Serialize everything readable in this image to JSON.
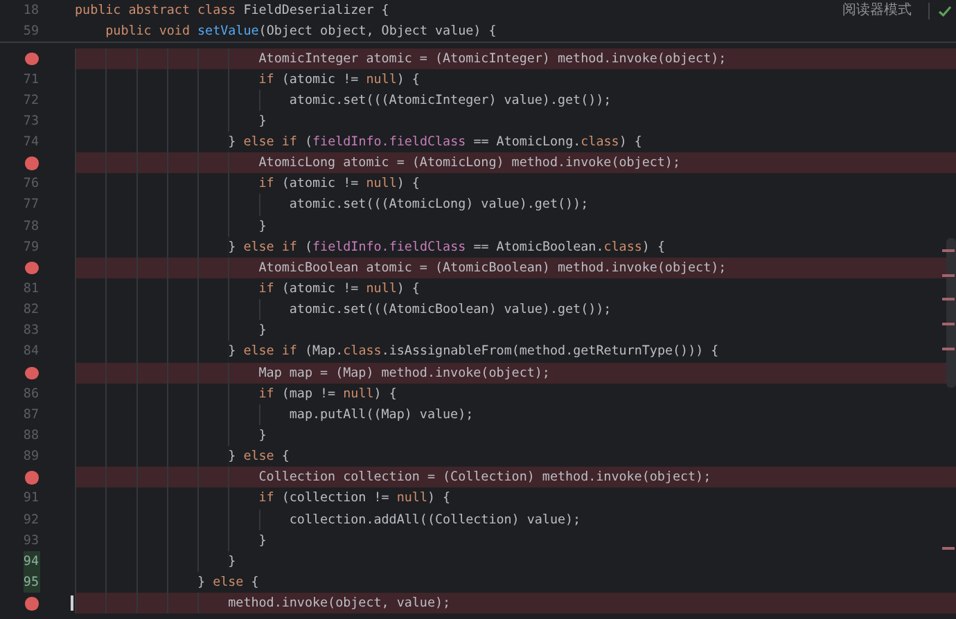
{
  "reader_mode": {
    "label": "阅读器模式"
  },
  "sticky_lines": [
    {
      "number": "18",
      "tokens": [
        {
          "text": "public abstract class",
          "kind": "keyword"
        },
        {
          "text": " FieldDeserializer {",
          "kind": "plain"
        }
      ]
    },
    {
      "number": "59",
      "tokens": [
        {
          "text": "    public void ",
          "kind": "keyword"
        },
        {
          "text": "setValue",
          "kind": "method"
        },
        {
          "text": "(Object object, Object value) {",
          "kind": "plain"
        }
      ]
    }
  ],
  "lines": [
    {
      "breakpoint": true,
      "changed": false,
      "tokens": [
        {
          "text": "                        AtomicInteger atomic = (AtomicInteger) method.invoke(object);",
          "kind": "plain"
        }
      ]
    },
    {
      "number": "71",
      "breakpoint": false,
      "changed": false,
      "tokens": [
        {
          "text": "                        if",
          "kind": "keyword"
        },
        {
          "text": " (atomic != ",
          "kind": "plain"
        },
        {
          "text": "null",
          "kind": "keyword"
        },
        {
          "text": ") {",
          "kind": "plain"
        }
      ]
    },
    {
      "number": "72",
      "breakpoint": false,
      "changed": false,
      "tokens": [
        {
          "text": "                            atomic.set(((AtomicInteger) value).get());",
          "kind": "plain"
        }
      ]
    },
    {
      "number": "73",
      "breakpoint": false,
      "changed": false,
      "tokens": [
        {
          "text": "                        }",
          "kind": "plain"
        }
      ]
    },
    {
      "number": "74",
      "breakpoint": false,
      "changed": false,
      "tokens": [
        {
          "text": "                    } ",
          "kind": "plain"
        },
        {
          "text": "else if",
          "kind": "keyword"
        },
        {
          "text": " (",
          "kind": "plain"
        },
        {
          "text": "fieldInfo.fieldClass",
          "kind": "field"
        },
        {
          "text": " == AtomicLong.",
          "kind": "plain"
        },
        {
          "text": "class",
          "kind": "keyword"
        },
        {
          "text": ") {",
          "kind": "plain"
        }
      ]
    },
    {
      "breakpoint": true,
      "changed": false,
      "tokens": [
        {
          "text": "                        AtomicLong atomic = (AtomicLong) method.invoke(object);",
          "kind": "plain"
        }
      ]
    },
    {
      "number": "76",
      "breakpoint": false,
      "changed": false,
      "tokens": [
        {
          "text": "                        if",
          "kind": "keyword"
        },
        {
          "text": " (atomic != ",
          "kind": "plain"
        },
        {
          "text": "null",
          "kind": "keyword"
        },
        {
          "text": ") {",
          "kind": "plain"
        }
      ]
    },
    {
      "number": "77",
      "breakpoint": false,
      "changed": false,
      "tokens": [
        {
          "text": "                            atomic.set(((AtomicLong) value).get());",
          "kind": "plain"
        }
      ]
    },
    {
      "number": "78",
      "breakpoint": false,
      "changed": false,
      "tokens": [
        {
          "text": "                        }",
          "kind": "plain"
        }
      ]
    },
    {
      "number": "79",
      "breakpoint": false,
      "changed": false,
      "tokens": [
        {
          "text": "                    } ",
          "kind": "plain"
        },
        {
          "text": "else if",
          "kind": "keyword"
        },
        {
          "text": " (",
          "kind": "plain"
        },
        {
          "text": "fieldInfo.fieldClass",
          "kind": "field"
        },
        {
          "text": " == AtomicBoolean.",
          "kind": "plain"
        },
        {
          "text": "class",
          "kind": "keyword"
        },
        {
          "text": ") {",
          "kind": "plain"
        }
      ]
    },
    {
      "breakpoint": true,
      "changed": false,
      "tokens": [
        {
          "text": "                        AtomicBoolean atomic = (AtomicBoolean) method.invoke(object);",
          "kind": "plain"
        }
      ]
    },
    {
      "number": "81",
      "breakpoint": false,
      "changed": false,
      "tokens": [
        {
          "text": "                        if",
          "kind": "keyword"
        },
        {
          "text": " (atomic != ",
          "kind": "plain"
        },
        {
          "text": "null",
          "kind": "keyword"
        },
        {
          "text": ") {",
          "kind": "plain"
        }
      ]
    },
    {
      "number": "82",
      "breakpoint": false,
      "changed": false,
      "tokens": [
        {
          "text": "                            atomic.set(((AtomicBoolean) value).get());",
          "kind": "plain"
        }
      ]
    },
    {
      "number": "83",
      "breakpoint": false,
      "changed": false,
      "tokens": [
        {
          "text": "                        }",
          "kind": "plain"
        }
      ]
    },
    {
      "number": "84",
      "breakpoint": false,
      "changed": false,
      "tokens": [
        {
          "text": "                    } ",
          "kind": "plain"
        },
        {
          "text": "else if",
          "kind": "keyword"
        },
        {
          "text": " (Map.",
          "kind": "plain"
        },
        {
          "text": "class",
          "kind": "keyword"
        },
        {
          "text": ".isAssignableFrom(method.getReturnType())) {",
          "kind": "plain"
        }
      ]
    },
    {
      "breakpoint": true,
      "changed": false,
      "tokens": [
        {
          "text": "                        Map map = (Map) method.invoke(object);",
          "kind": "plain"
        }
      ]
    },
    {
      "number": "86",
      "breakpoint": false,
      "changed": false,
      "tokens": [
        {
          "text": "                        if",
          "kind": "keyword"
        },
        {
          "text": " (map != ",
          "kind": "plain"
        },
        {
          "text": "null",
          "kind": "keyword"
        },
        {
          "text": ") {",
          "kind": "plain"
        }
      ]
    },
    {
      "number": "87",
      "breakpoint": false,
      "changed": false,
      "tokens": [
        {
          "text": "                            map.putAll((Map) value);",
          "kind": "plain"
        }
      ]
    },
    {
      "number": "88",
      "breakpoint": false,
      "changed": false,
      "tokens": [
        {
          "text": "                        }",
          "kind": "plain"
        }
      ]
    },
    {
      "number": "89",
      "breakpoint": false,
      "changed": false,
      "tokens": [
        {
          "text": "                    } ",
          "kind": "plain"
        },
        {
          "text": "else",
          "kind": "keyword"
        },
        {
          "text": " {",
          "kind": "plain"
        }
      ]
    },
    {
      "breakpoint": true,
      "changed": false,
      "tokens": [
        {
          "text": "                        Collection collection = (Collection) method.invoke(object);",
          "kind": "plain"
        }
      ]
    },
    {
      "number": "91",
      "breakpoint": false,
      "changed": false,
      "tokens": [
        {
          "text": "                        if",
          "kind": "keyword"
        },
        {
          "text": " (collection != ",
          "kind": "plain"
        },
        {
          "text": "null",
          "kind": "keyword"
        },
        {
          "text": ") {",
          "kind": "plain"
        }
      ]
    },
    {
      "number": "92",
      "breakpoint": false,
      "changed": false,
      "tokens": [
        {
          "text": "                            collection.addAll((Collection) value);",
          "kind": "plain"
        }
      ]
    },
    {
      "number": "93",
      "breakpoint": false,
      "changed": false,
      "tokens": [
        {
          "text": "                        }",
          "kind": "plain"
        }
      ]
    },
    {
      "number": "94",
      "breakpoint": false,
      "changed": true,
      "tokens": [
        {
          "text": "                    }",
          "kind": "plain"
        }
      ]
    },
    {
      "number": "95",
      "breakpoint": false,
      "changed": true,
      "tokens": [
        {
          "text": "                } ",
          "kind": "plain"
        },
        {
          "text": "else",
          "kind": "keyword"
        },
        {
          "text": " {",
          "kind": "plain"
        }
      ]
    },
    {
      "breakpoint": true,
      "changed": false,
      "tokens": [
        {
          "text": "                    method.invoke(object, value);",
          "kind": "plain"
        }
      ]
    }
  ]
}
